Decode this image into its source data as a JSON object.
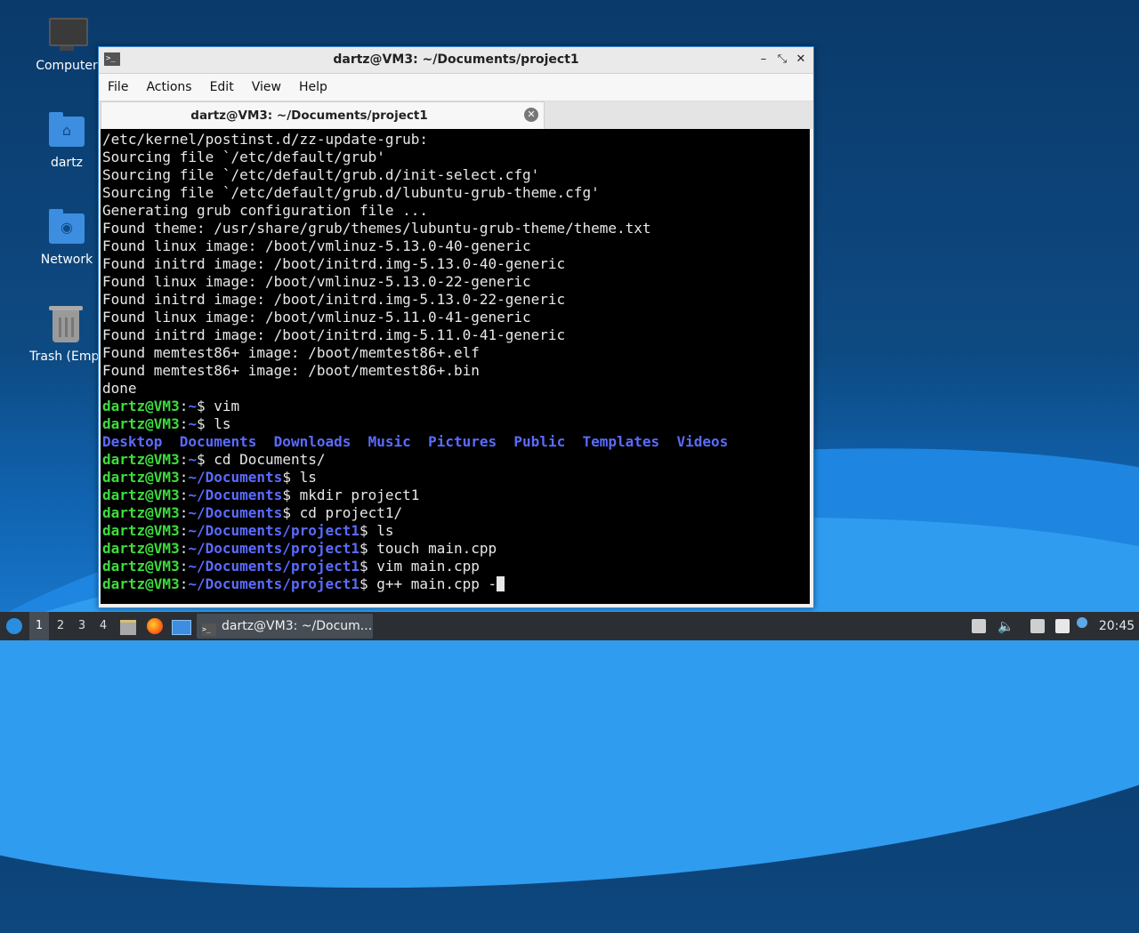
{
  "desktop": {
    "icons": [
      {
        "label": "Computer"
      },
      {
        "label": "dartz"
      },
      {
        "label": "Network"
      },
      {
        "label": "Trash (Empt"
      }
    ]
  },
  "window": {
    "title": "dartz@VM3: ~/Documents/project1",
    "menu": [
      "File",
      "Actions",
      "Edit",
      "View",
      "Help"
    ],
    "tab_label": "dartz@VM3: ~/Documents/project1",
    "controls": {
      "minimize": "–",
      "restore": "⤡",
      "close": "✕"
    }
  },
  "terminal": {
    "output_lines": [
      "/etc/kernel/postinst.d/zz-update-grub:",
      "Sourcing file `/etc/default/grub'",
      "Sourcing file `/etc/default/grub.d/init-select.cfg'",
      "Sourcing file `/etc/default/grub.d/lubuntu-grub-theme.cfg'",
      "Generating grub configuration file ...",
      "Found theme: /usr/share/grub/themes/lubuntu-grub-theme/theme.txt",
      "Found linux image: /boot/vmlinuz-5.13.0-40-generic",
      "Found initrd image: /boot/initrd.img-5.13.0-40-generic",
      "Found linux image: /boot/vmlinuz-5.13.0-22-generic",
      "Found initrd image: /boot/initrd.img-5.13.0-22-generic",
      "Found linux image: /boot/vmlinuz-5.11.0-41-generic",
      "Found initrd image: /boot/initrd.img-5.11.0-41-generic",
      "Found memtest86+ image: /boot/memtest86+.elf",
      "Found memtest86+ image: /boot/memtest86+.bin",
      "done"
    ],
    "user_host": "dartz@VM3",
    "commands": [
      {
        "path": "~",
        "cmd": "vim"
      },
      {
        "path": "~",
        "cmd": "ls"
      },
      {
        "path": "~",
        "cmd": "cd Documents/"
      },
      {
        "path": "~/Documents",
        "cmd": "ls"
      },
      {
        "path": "~/Documents",
        "cmd": "mkdir project1"
      },
      {
        "path": "~/Documents",
        "cmd": "cd project1/"
      },
      {
        "path": "~/Documents/project1",
        "cmd": "ls"
      },
      {
        "path": "~/Documents/project1",
        "cmd": "touch main.cpp"
      },
      {
        "path": "~/Documents/project1",
        "cmd": "vim main.cpp"
      },
      {
        "path": "~/Documents/project1",
        "cmd": "g++ main.cpp -"
      }
    ],
    "ls_dirs": [
      "Desktop",
      "Documents",
      "Downloads",
      "Music",
      "Pictures",
      "Public",
      "Templates",
      "Videos"
    ]
  },
  "taskbar": {
    "workspaces": [
      "1",
      "2",
      "3",
      "4"
    ],
    "active_workspace": "1",
    "task_label": "dartz@VM3: ~/Docum...",
    "clock": "20:45"
  }
}
